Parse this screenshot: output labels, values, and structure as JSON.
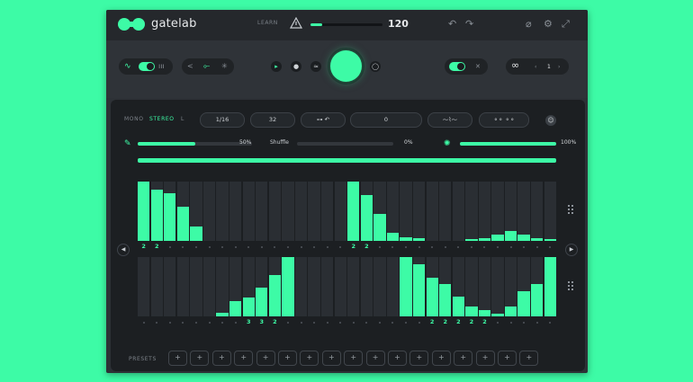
{
  "app": {
    "name": "gatelab"
  },
  "header": {
    "learn_label": "LEARN",
    "tempo": 120,
    "tempo_fraction": 0.16
  },
  "controls": {
    "wave_labels": [
      "∿",
      "ııı"
    ]
  },
  "pattern_panel": {
    "mono_label": "MONO",
    "stereo_label": "STEREO",
    "channel_label": "L",
    "rate_value": "1/16",
    "steps_value": "32",
    "pattern_value": "0"
  },
  "sliders": [
    {
      "name": "smooth",
      "percent_label": "50%",
      "value": 0.5
    },
    {
      "name": "shuffle",
      "label": "Shuffle",
      "percent_label": "0%",
      "value": 0.0
    },
    {
      "name": "mix",
      "percent_label": "100%",
      "value": 1.0
    }
  ],
  "lanes": [
    {
      "values": [
        1.0,
        0.87,
        0.8,
        0.58,
        0.25,
        0,
        0,
        0,
        0,
        0,
        0,
        0,
        0,
        0,
        0,
        0,
        1.0,
        0.77,
        0.45,
        0.13,
        0.06,
        0.04,
        0,
        0,
        0,
        0.03,
        0.05,
        0.1,
        0.16,
        0.1,
        0.05,
        0.03
      ],
      "step_labels": [
        "2",
        "2",
        "",
        "",
        "",
        "",
        "",
        "",
        "",
        "",
        "",
        "",
        "",
        "",
        "",
        "",
        "2",
        "2",
        "",
        "",
        "",
        "",
        "",
        "",
        "",
        "",
        "",
        "",
        "",
        "",
        "",
        ""
      ]
    },
    {
      "values": [
        0,
        0,
        0,
        0,
        0,
        0,
        0.06,
        0.26,
        0.32,
        0.49,
        0.7,
        1.0,
        0,
        0,
        0,
        0,
        0,
        0,
        0,
        0,
        1.0,
        0.88,
        0.65,
        0.55,
        0.33,
        0.17,
        0.1,
        0.03,
        0,
        0,
        0,
        0
      ],
      "values_tail": [
        0.04,
        0.16,
        0.42,
        0.55,
        1.0
      ],
      "step_labels": [
        "",
        "",
        "",
        "",
        "",
        "",
        "",
        "",
        "3",
        "3",
        "2",
        "",
        "",
        "",
        "",
        "",
        "",
        "",
        "",
        "",
        "",
        "",
        "2",
        "2",
        "2",
        "2",
        "2",
        "",
        "",
        "",
        "",
        ""
      ]
    }
  ],
  "presets": {
    "label": "PRESETS",
    "slots": [
      "+",
      "+",
      "+",
      "+",
      "+",
      "+",
      "+",
      "+",
      "+",
      "+",
      "+",
      "+",
      "+",
      "+",
      "+",
      "+",
      "+"
    ]
  }
}
